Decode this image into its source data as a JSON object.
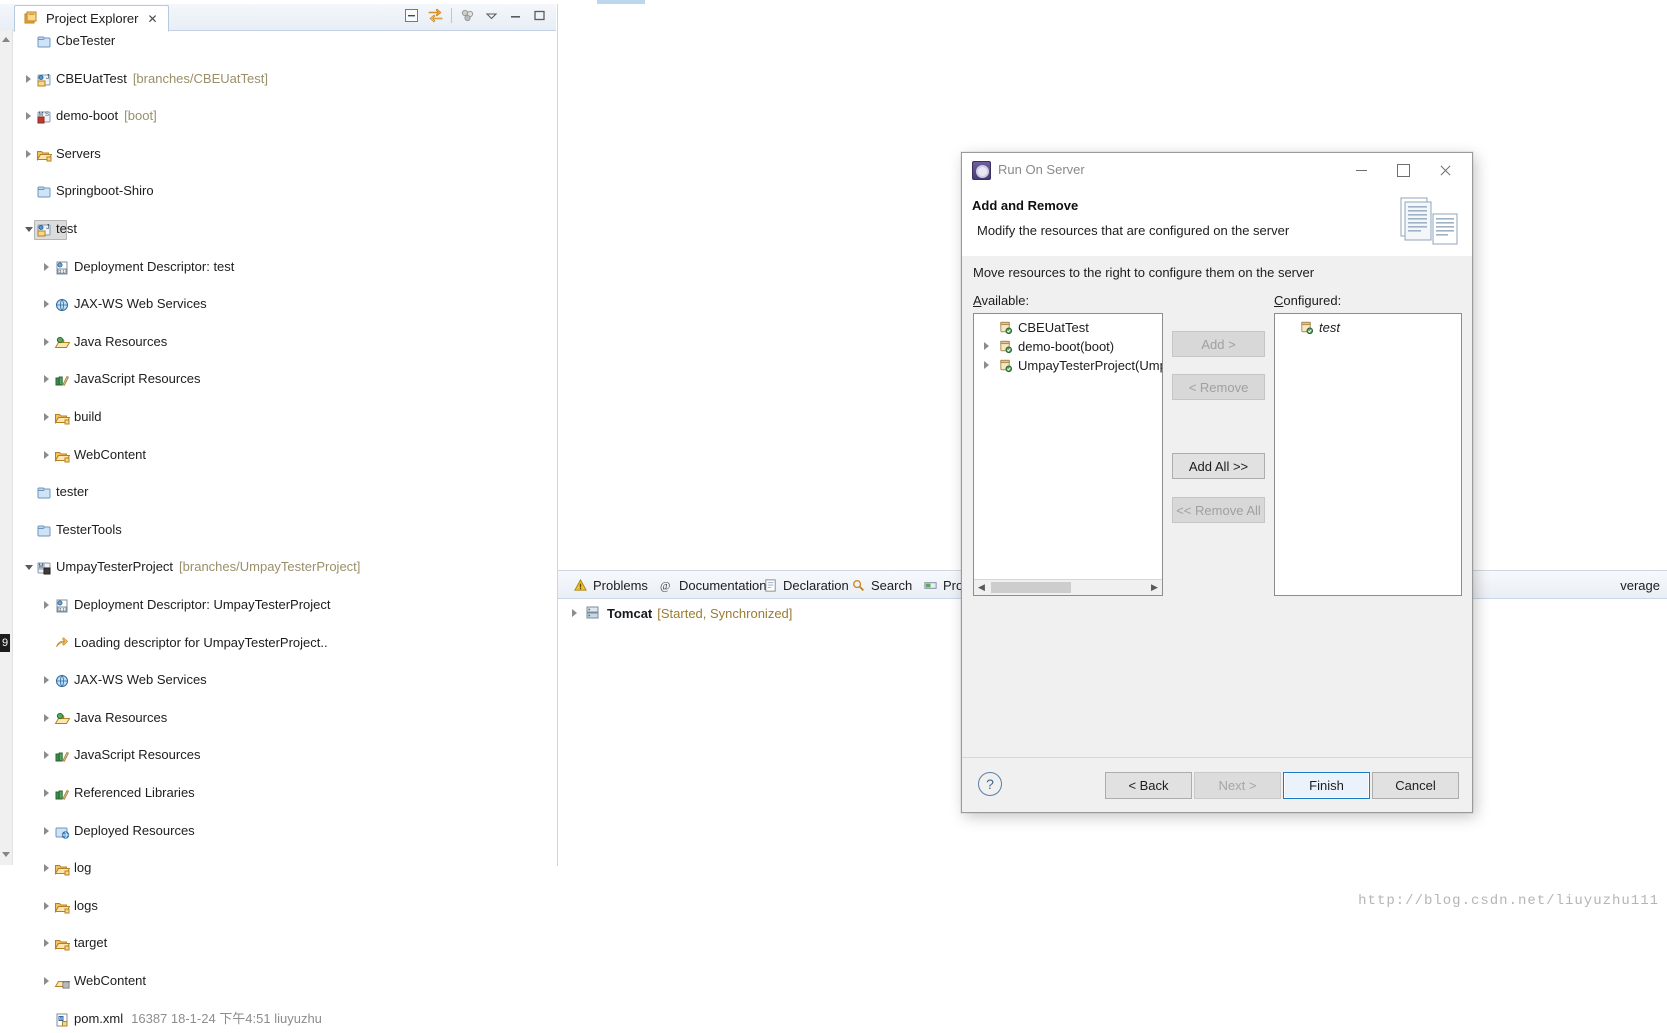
{
  "explorer": {
    "tab_label": "Project Explorer",
    "close_glyph": "✕",
    "tools": [
      "collapse-all-icon",
      "link-with-editor-icon",
      "view-filter-icon",
      "view-menu-icon",
      "minimize-icon",
      "maximize-icon"
    ],
    "tree": [
      {
        "label": "CbeTester",
        "icon": "blue-folder-icon",
        "indent": 0,
        "twist": "none",
        "dim": "",
        "selected": false
      },
      {
        "label": "CBEUatTest",
        "icon": "java-web-project-icon",
        "indent": 0,
        "twist": "closed",
        "dim": "[branches/CBEUatTest]",
        "selected": false
      },
      {
        "label": "demo-boot",
        "icon": "maven-project-icon",
        "indent": 0,
        "twist": "closed",
        "dim": "[boot]",
        "selected": false
      },
      {
        "label": "Servers",
        "icon": "open-folder-icon",
        "indent": 0,
        "twist": "closed",
        "dim": "",
        "selected": false
      },
      {
        "label": "Springboot-Shiro",
        "icon": "blue-folder-icon",
        "indent": 0,
        "twist": "none",
        "dim": "",
        "selected": false
      },
      {
        "label": "test",
        "icon": "java-web-project-icon",
        "indent": 0,
        "twist": "open",
        "dim": "",
        "selected": true
      },
      {
        "label": "Deployment Descriptor: test",
        "icon": "deployment-descriptor-icon",
        "indent": 1,
        "twist": "closed",
        "dim": "",
        "selected": false
      },
      {
        "label": "JAX-WS Web Services",
        "icon": "jaxws-icon",
        "indent": 1,
        "twist": "closed",
        "dim": "",
        "selected": false
      },
      {
        "label": "Java Resources",
        "icon": "java-resources-icon",
        "indent": 1,
        "twist": "closed",
        "dim": "",
        "selected": false
      },
      {
        "label": "JavaScript Resources",
        "icon": "javascript-resources-icon",
        "indent": 1,
        "twist": "closed",
        "dim": "",
        "selected": false
      },
      {
        "label": "build",
        "icon": "open-folder-icon",
        "indent": 1,
        "twist": "closed",
        "dim": "",
        "selected": false
      },
      {
        "label": "WebContent",
        "icon": "open-folder-icon",
        "indent": 1,
        "twist": "closed",
        "dim": "",
        "selected": false
      },
      {
        "label": "tester",
        "icon": "blue-folder-icon",
        "indent": 0,
        "twist": "none",
        "dim": "",
        "selected": false
      },
      {
        "label": "TesterTools",
        "icon": "blue-folder-icon",
        "indent": 0,
        "twist": "none",
        "dim": "",
        "selected": false
      },
      {
        "label": "UmpayTesterProject",
        "icon": "maven-java-web-project-icon",
        "indent": 0,
        "twist": "open",
        "dim": "[branches/UmpayTesterProject]",
        "selected": false
      },
      {
        "label": "Deployment Descriptor: UmpayTesterProject",
        "icon": "deployment-descriptor-icon",
        "indent": 1,
        "twist": "closed",
        "dim": "",
        "selected": false
      },
      {
        "label": "Loading descriptor for UmpayTesterProject..",
        "icon": "loading-arrow-icon",
        "indent": 1,
        "twist": "none",
        "dim": "",
        "selected": false
      },
      {
        "label": "JAX-WS Web Services",
        "icon": "jaxws-icon",
        "indent": 1,
        "twist": "closed",
        "dim": "",
        "selected": false
      },
      {
        "label": "Java Resources",
        "icon": "java-resources-icon",
        "indent": 1,
        "twist": "closed",
        "dim": "",
        "selected": false
      },
      {
        "label": "JavaScript Resources",
        "icon": "javascript-resources-icon",
        "indent": 1,
        "twist": "closed",
        "dim": "",
        "selected": false
      },
      {
        "label": "Referenced Libraries",
        "icon": "referenced-libraries-icon",
        "indent": 1,
        "twist": "closed",
        "dim": "",
        "selected": false
      },
      {
        "label": "Deployed Resources",
        "icon": "deployed-resources-icon",
        "indent": 1,
        "twist": "closed",
        "dim": "",
        "selected": false
      },
      {
        "label": "log",
        "icon": "open-folder-icon",
        "indent": 1,
        "twist": "closed",
        "dim": "",
        "selected": false
      },
      {
        "label": "logs",
        "icon": "open-folder-icon",
        "indent": 1,
        "twist": "closed",
        "dim": "",
        "selected": false
      },
      {
        "label": "target",
        "icon": "open-folder-icon",
        "indent": 1,
        "twist": "closed",
        "dim": "",
        "selected": false
      },
      {
        "label": "WebContent",
        "icon": "web-content-folder-icon",
        "indent": 1,
        "twist": "closed",
        "dim": "",
        "selected": false
      },
      {
        "label": "pom.xml",
        "icon": "pom-file-icon",
        "indent": 1,
        "twist": "none",
        "dim": "",
        "meta": "16387  18-1-24 下午4:51  liuyuzhu",
        "selected": false
      }
    ]
  },
  "bottom_panel": {
    "tabs": [
      {
        "label": "Problems",
        "icon": "problems-icon",
        "active": false
      },
      {
        "label": "Documentation",
        "icon": "documentation-icon",
        "active": false
      },
      {
        "label": "Declaration",
        "icon": "declaration-icon",
        "active": false
      },
      {
        "label": "Search",
        "icon": "search-icon",
        "active": false
      },
      {
        "label": "Progr",
        "icon": "progress-icon",
        "active": false
      }
    ],
    "coverage_label": "verage",
    "server": {
      "name": "Tomcat",
      "state": "[Started, Synchronized]",
      "icon": "server-icon",
      "twist": "closed"
    }
  },
  "edge_badge": "9",
  "dialog": {
    "title": "Run On Server",
    "title_icon": "run-on-server-icon",
    "window_buttons": [
      "minimize-icon",
      "maximize-icon",
      "close-icon"
    ],
    "heading": "Add and Remove",
    "subheading": "Modify the resources that are configured on the server",
    "hint": "Move resources to the right to configure them on the server",
    "available_label": "Available:",
    "available_mnemonic": "A",
    "configured_label": "Configured:",
    "configured_mnemonic": "C",
    "available_items": [
      {
        "label": "CBEUatTest",
        "twist": "none",
        "icon": "module-icon"
      },
      {
        "label": "demo-boot(boot)",
        "twist": "closed",
        "icon": "module-icon"
      },
      {
        "label": "UmpayTesterProject(Umpa",
        "twist": "closed",
        "icon": "module-icon"
      }
    ],
    "configured_items": [
      {
        "label": "test",
        "twist": "none",
        "icon": "module-icon",
        "italic": true
      }
    ],
    "transfer_buttons": [
      {
        "label": "Add >",
        "name": "add-button",
        "disabled": true
      },
      {
        "label": "< Remove",
        "name": "remove-button",
        "disabled": true
      },
      {
        "label": "Add All >>",
        "name": "add-all-button",
        "disabled": false
      },
      {
        "label": "<< Remove All",
        "name": "remove-all-button",
        "disabled": true
      }
    ],
    "footer_buttons": [
      {
        "label": "< Back",
        "name": "back-button",
        "disabled": false,
        "default": false
      },
      {
        "label": "Next >",
        "name": "next-button",
        "disabled": true,
        "default": false
      },
      {
        "label": "Finish",
        "name": "finish-button",
        "disabled": false,
        "default": true
      },
      {
        "label": "Cancel",
        "name": "cancel-button",
        "disabled": false,
        "default": false
      }
    ],
    "help_glyph": "?"
  },
  "watermark": "http://blog.csdn.net/liuyuzhu111"
}
